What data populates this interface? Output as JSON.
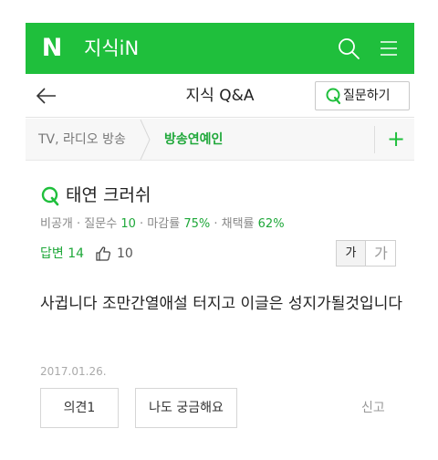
{
  "header": {
    "logo_letter": "N",
    "app_title": "지식iN",
    "brand_color": "#1fbf3c",
    "search_icon": "search-icon",
    "menu_icon": "hamburger-menu-icon"
  },
  "subheader": {
    "back_icon": "back-arrow-icon",
    "title": "지식 Q&A",
    "ask_button_label": "질문하기"
  },
  "breadcrumb": {
    "items": [
      "TV, 라디오 방송",
      "방송연예인"
    ],
    "add_icon": "+"
  },
  "question": {
    "title": "태연 크러쉬",
    "meta": {
      "visibility": "비공개",
      "questions_label": "질문수",
      "questions_value": "10",
      "deadline_label": "마감률",
      "deadline_value": "75%",
      "adopt_label": "채택률",
      "adopt_value": "62%"
    },
    "answers_label": "답변 14",
    "likes": "10",
    "font_small": "가",
    "font_large": "가",
    "body": "사귑니다 조만간열애설 터지고 이글은 성지가될것입니다",
    "date": "2017.01.26."
  },
  "actions": {
    "opinion_label": "의견1",
    "curious_label": "나도 궁금해요",
    "report_label": "신고"
  }
}
